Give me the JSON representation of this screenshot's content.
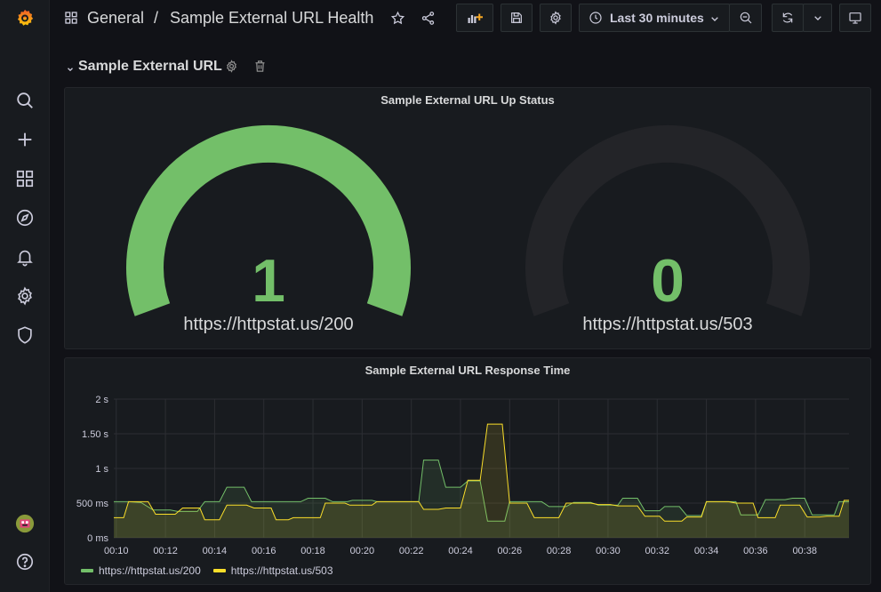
{
  "breadcrumb": {
    "folder": "General",
    "separator": "/",
    "dashboard": "Sample External URL Health"
  },
  "toolbar": {
    "time_range": "Last 30 minutes"
  },
  "row": {
    "title": "Sample External URL"
  },
  "gauge_panel": {
    "title": "Sample External URL Up Status",
    "gauges": [
      {
        "value": "1",
        "label": "https://httpstat.us/200",
        "fill_fraction": 1,
        "color": "#73bf69"
      },
      {
        "value": "0",
        "label": "https://httpstat.us/503",
        "fill_fraction": 0,
        "color": "#73bf69"
      }
    ]
  },
  "timeseries_panel": {
    "title": "Sample External URL Response Time",
    "legend": [
      {
        "label": "https://httpstat.us/200",
        "color": "#73bf69"
      },
      {
        "label": "https://httpstat.us/503",
        "color": "#fade2a"
      }
    ]
  },
  "chart_data": {
    "type": "line",
    "title": "Sample External URL Response Time",
    "y_tick_labels": [
      "0 ms",
      "500 ms",
      "1 s",
      "1.50 s",
      "2 s"
    ],
    "y_tick_values": [
      0,
      500,
      1000,
      1500,
      2000
    ],
    "x_tick_labels": [
      "00:10",
      "00:12",
      "00:14",
      "00:16",
      "00:18",
      "00:20",
      "00:22",
      "00:24",
      "00:26",
      "00:28",
      "00:30",
      "00:32",
      "00:34",
      "00:36",
      "00:38"
    ],
    "x_range_minutes": [
      9.9,
      39.8
    ],
    "ylim": [
      0,
      2000
    ],
    "grid": true,
    "legend_placement": "bottom-left",
    "series": [
      {
        "name": "https://httpstat.us/200",
        "color": "#73bf69",
        "points": [
          [
            9.9,
            520
          ],
          [
            10.5,
            520
          ],
          [
            11.0,
            510
          ],
          [
            11.5,
            400
          ],
          [
            12.2,
            400
          ],
          [
            12.5,
            380
          ],
          [
            13.3,
            380
          ],
          [
            13.6,
            520
          ],
          [
            14.2,
            520
          ],
          [
            14.5,
            730
          ],
          [
            15.2,
            730
          ],
          [
            15.5,
            520
          ],
          [
            17.5,
            520
          ],
          [
            17.8,
            570
          ],
          [
            18.5,
            570
          ],
          [
            18.8,
            520
          ],
          [
            19.4,
            520
          ],
          [
            19.6,
            540
          ],
          [
            20.4,
            540
          ],
          [
            20.6,
            520
          ],
          [
            22.3,
            520
          ],
          [
            22.5,
            1120
          ],
          [
            23.1,
            1120
          ],
          [
            23.4,
            730
          ],
          [
            24.0,
            730
          ],
          [
            24.3,
            820
          ],
          [
            24.8,
            820
          ],
          [
            25.1,
            240
          ],
          [
            25.8,
            240
          ],
          [
            26.0,
            520
          ],
          [
            27.3,
            520
          ],
          [
            27.6,
            450
          ],
          [
            28.3,
            450
          ],
          [
            28.6,
            510
          ],
          [
            29.3,
            510
          ],
          [
            29.6,
            470
          ],
          [
            30.4,
            470
          ],
          [
            30.6,
            570
          ],
          [
            31.2,
            570
          ],
          [
            31.5,
            390
          ],
          [
            32.1,
            390
          ],
          [
            32.3,
            450
          ],
          [
            32.9,
            450
          ],
          [
            33.2,
            320
          ],
          [
            33.8,
            320
          ],
          [
            34.0,
            520
          ],
          [
            35.2,
            520
          ],
          [
            35.4,
            330
          ],
          [
            36.1,
            330
          ],
          [
            36.4,
            550
          ],
          [
            37.2,
            550
          ],
          [
            37.5,
            570
          ],
          [
            38.0,
            570
          ],
          [
            38.3,
            330
          ],
          [
            39.2,
            330
          ],
          [
            39.4,
            520
          ],
          [
            39.8,
            520
          ]
        ]
      },
      {
        "name": "https://httpstat.us/503",
        "color": "#fade2a",
        "points": [
          [
            9.9,
            290
          ],
          [
            10.3,
            290
          ],
          [
            10.5,
            520
          ],
          [
            11.3,
            520
          ],
          [
            11.6,
            340
          ],
          [
            12.4,
            340
          ],
          [
            12.7,
            430
          ],
          [
            13.4,
            430
          ],
          [
            13.6,
            260
          ],
          [
            14.2,
            260
          ],
          [
            14.5,
            470
          ],
          [
            15.3,
            470
          ],
          [
            15.6,
            430
          ],
          [
            16.3,
            430
          ],
          [
            16.5,
            260
          ],
          [
            17.0,
            260
          ],
          [
            17.2,
            290
          ],
          [
            18.3,
            290
          ],
          [
            18.5,
            500
          ],
          [
            19.3,
            500
          ],
          [
            19.5,
            470
          ],
          [
            20.4,
            470
          ],
          [
            20.6,
            520
          ],
          [
            22.3,
            520
          ],
          [
            22.5,
            410
          ],
          [
            23.1,
            410
          ],
          [
            23.4,
            430
          ],
          [
            24.0,
            430
          ],
          [
            24.3,
            830
          ],
          [
            24.8,
            830
          ],
          [
            25.1,
            1640
          ],
          [
            25.7,
            1640
          ],
          [
            26.0,
            500
          ],
          [
            26.7,
            500
          ],
          [
            27.0,
            290
          ],
          [
            28.0,
            290
          ],
          [
            28.3,
            500
          ],
          [
            29.3,
            500
          ],
          [
            29.6,
            480
          ],
          [
            30.1,
            480
          ],
          [
            30.4,
            460
          ],
          [
            31.2,
            460
          ],
          [
            31.5,
            310
          ],
          [
            32.1,
            310
          ],
          [
            32.3,
            240
          ],
          [
            33.0,
            240
          ],
          [
            33.2,
            300
          ],
          [
            33.8,
            300
          ],
          [
            34.0,
            520
          ],
          [
            34.9,
            520
          ],
          [
            35.2,
            500
          ],
          [
            35.9,
            500
          ],
          [
            36.1,
            290
          ],
          [
            36.8,
            290
          ],
          [
            37.0,
            470
          ],
          [
            37.8,
            470
          ],
          [
            38.1,
            300
          ],
          [
            38.6,
            300
          ],
          [
            38.9,
            310
          ],
          [
            39.4,
            310
          ],
          [
            39.6,
            540
          ],
          [
            39.8,
            540
          ]
        ]
      }
    ]
  }
}
